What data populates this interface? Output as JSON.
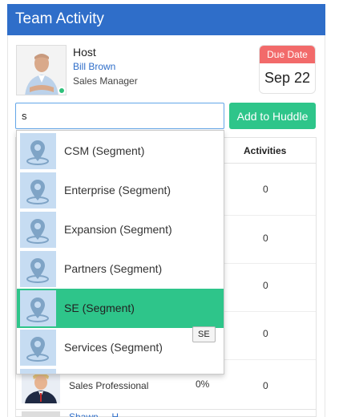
{
  "header": {
    "title": "Team Activity"
  },
  "host": {
    "role_label": "Host",
    "name": "Bill Brown",
    "title": "Sales Manager",
    "online_color": "#2ec07a"
  },
  "due": {
    "label": "Due Date",
    "date": "Sep 22",
    "accent": "#f26a6a"
  },
  "search": {
    "value": "s"
  },
  "add_button": {
    "label": "Add to Huddle",
    "color": "#2ec58a"
  },
  "table": {
    "activities_header": "Activities",
    "activities": [
      "0",
      "0",
      "0",
      "0"
    ],
    "visible_row": {
      "title": "Sales Professional",
      "percent": "0%",
      "activities": "0"
    },
    "next_row_link": "Shawn ... H..."
  },
  "dropdown": {
    "items": [
      {
        "label": "CSM (Segment)",
        "icon": "location-pin-icon"
      },
      {
        "label": "Enterprise (Segment)",
        "icon": "location-pin-icon"
      },
      {
        "label": "Expansion (Segment)",
        "icon": "location-pin-icon"
      },
      {
        "label": "Partners (Segment)",
        "icon": "location-pin-icon"
      },
      {
        "label": "SE (Segment)",
        "icon": "location-pin-icon",
        "active": true
      },
      {
        "label": "Services (Segment)",
        "icon": "location-pin-icon"
      }
    ],
    "active_color": "#2ec58a"
  },
  "tooltip": {
    "text": "SE"
  },
  "colors": {
    "header": "#2f6ec9",
    "link": "#2f6ec9"
  }
}
